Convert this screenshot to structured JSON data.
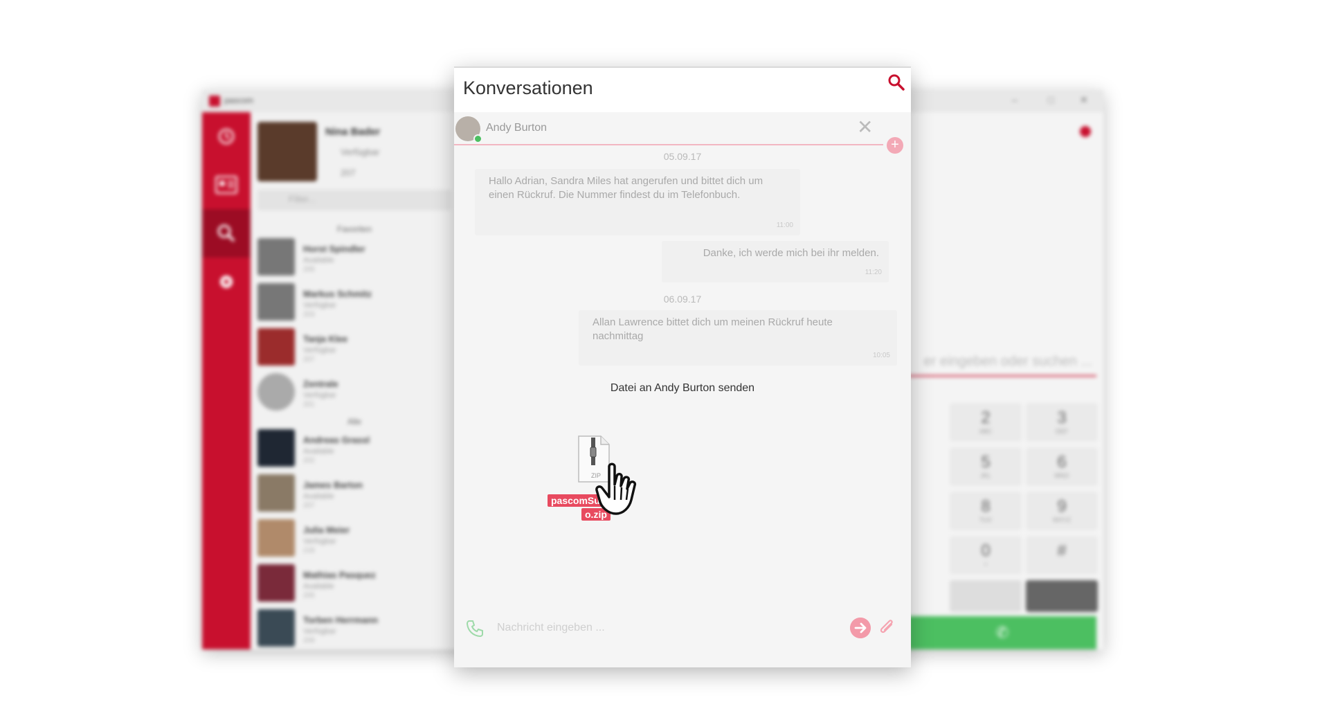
{
  "background_app": {
    "app_title": "pascom",
    "window_controls": [
      "–",
      "□",
      "✕"
    ],
    "rail": [
      {
        "icon": "history-icon"
      },
      {
        "icon": "contacts-icon"
      },
      {
        "icon": "search-icon",
        "active": true
      },
      {
        "icon": "settings-icon"
      }
    ],
    "profile": {
      "name": "Nina Bader",
      "status": "Verfügbar",
      "ext": "207"
    },
    "filter_placeholder": "Filter...",
    "favorites_label": "Favoriten",
    "all_label": "Alle",
    "contacts": [
      {
        "name": "Horst Spindler",
        "status": "Available",
        "ext": "205"
      },
      {
        "name": "Markus Schmitz",
        "status": "Verfügbar",
        "ext": "203"
      },
      {
        "name": "Tanja Klee",
        "status": "Verfügbar",
        "ext": "207"
      },
      {
        "name": "Zentrale",
        "status": "Verfügbar",
        "ext": "201"
      },
      {
        "name": "Andreas Grassl",
        "status": "Available",
        "ext": "202"
      },
      {
        "name": "James Barton",
        "status": "Available",
        "ext": "207"
      },
      {
        "name": "Julia Meier",
        "status": "Verfügbar",
        "ext": "218"
      },
      {
        "name": "Mathias Pasquez",
        "status": "Available",
        "ext": "205"
      },
      {
        "name": "Torben Herrmann",
        "status": "Verfügbar",
        "ext": "209"
      }
    ],
    "dialer": {
      "input_placeholder": "er eingeben oder suchen ...",
      "keys": [
        {
          "num": "2",
          "sub": "ABC"
        },
        {
          "num": "3",
          "sub": "DEF"
        },
        {
          "num": "5",
          "sub": "JKL"
        },
        {
          "num": "6",
          "sub": "MNO"
        },
        {
          "num": "8",
          "sub": "TUV"
        },
        {
          "num": "9",
          "sub": "WXYZ"
        },
        {
          "num": "0",
          "sub": "+"
        },
        {
          "num": "#",
          "sub": ""
        }
      ]
    }
  },
  "conversation": {
    "title": "Konversationen",
    "recipient": "Andy Burton",
    "messages": [
      {
        "date": "05.09.17"
      },
      {
        "text": "Hallo Adrian, Sandra Miles hat angerufen und bittet dich um einen Rückruf. Die Nummer findest du im Telefonbuch.",
        "time": "11:00",
        "side": "left"
      },
      {
        "text": "Danke, ich werde mich bei ihr melden.",
        "time": "11:20",
        "side": "right"
      },
      {
        "date": "06.09.17"
      },
      {
        "text": "Allan Lawrence bittet dich um meinen Rückruf heute nachmittag",
        "time": "10:05",
        "side": "right"
      }
    ],
    "drop_label": "Datei an Andy Burton senden",
    "file_name_line1": "pascomSu",
    "file_name_line2": "o.zip",
    "composer_placeholder": "Nachricht eingeben ..."
  },
  "colors": {
    "brand": "#c8102e",
    "call_green": "#4cbf61",
    "file_badge": "#e84a5f"
  }
}
